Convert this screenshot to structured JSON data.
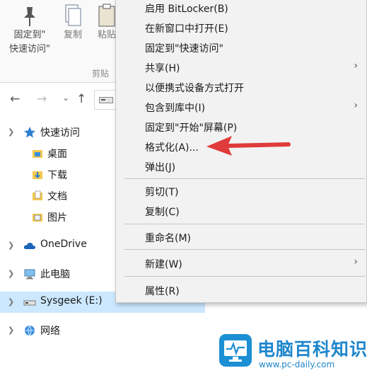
{
  "ribbon": {
    "pin_label_line1": "固定到\"",
    "pin_label_line2": "快速访问\"",
    "copy_label": "复制",
    "paste_label": "粘贴",
    "group_label": "剪贴"
  },
  "navigation": {
    "back": "←",
    "forward": "→",
    "history": "⌄",
    "up": "↑"
  },
  "pane": {
    "quick_access": "快速访问",
    "desktop": "桌面",
    "downloads": "下载",
    "documents": "文档",
    "pictures": "图片",
    "onedrive": "OneDrive",
    "this_pc": "此电脑",
    "drive": "Sysgeek (E:)",
    "network": "网络"
  },
  "context_menu": {
    "items": [
      {
        "label": "启用 BitLocker(B)"
      },
      {
        "label": "在新窗口中打开(E)"
      },
      {
        "label": "固定到\"快速访问\""
      },
      {
        "label": "共享(H)"
      },
      {
        "label": "以便携式设备方式打开"
      },
      {
        "label": "包含到库中(I)"
      },
      {
        "label": "固定到\"开始\"屏幕(P)"
      },
      {
        "label": "格式化(A)..."
      },
      {
        "label": "弹出(J)"
      },
      {
        "label": "剪切(T)"
      },
      {
        "label": "复制(C)"
      },
      {
        "label": "重命名(M)"
      },
      {
        "label": "新建(W)"
      },
      {
        "label": "属性(R)"
      }
    ],
    "submenu_arrow": "›"
  },
  "watermark": {
    "title": "电脑百科知识",
    "url": "www.pc-daily.com"
  },
  "colors": {
    "selection": "#cce8ff",
    "menu_background": "#f2f2f2",
    "annotation_arrow": "#e03b3b",
    "watermark_blue": "#1e86cc"
  }
}
